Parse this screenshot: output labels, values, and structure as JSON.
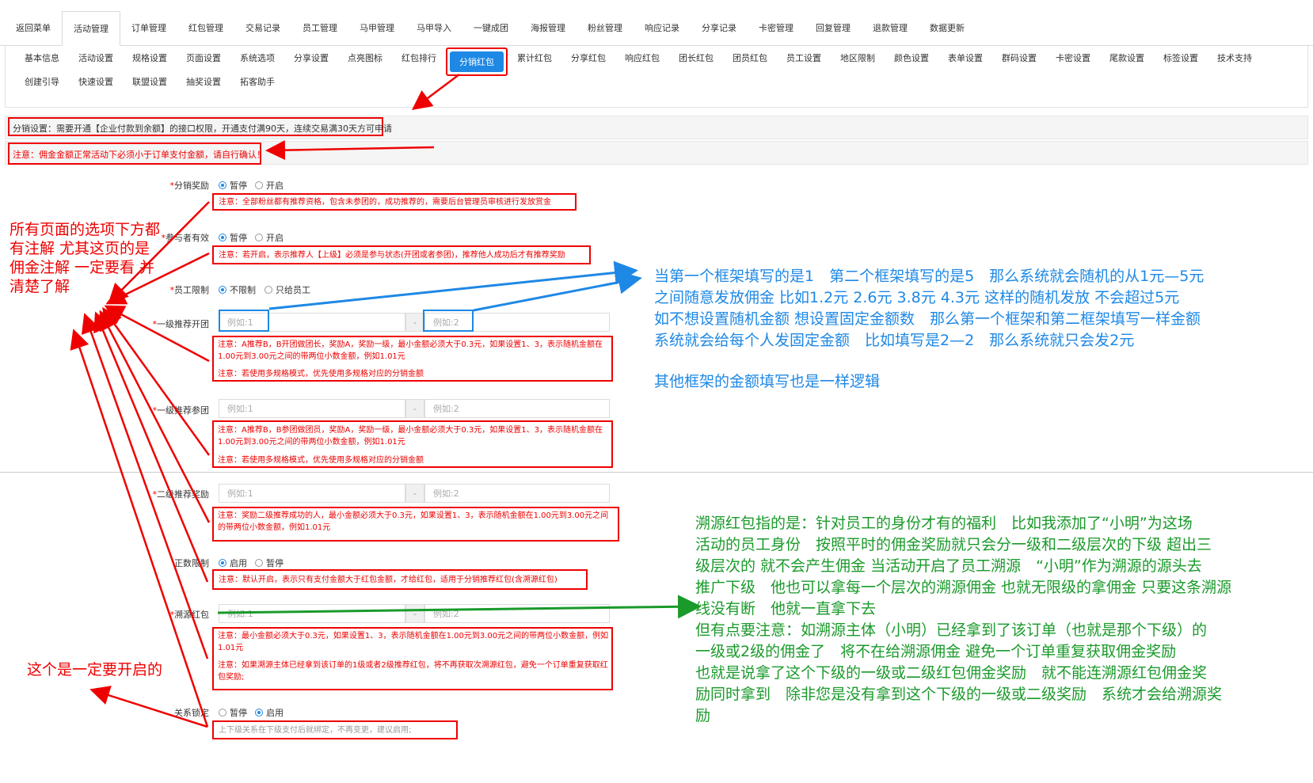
{
  "top_tabs": [
    "返回菜单",
    "活动管理",
    "订单管理",
    "红包管理",
    "交易记录",
    "员工管理",
    "马甲管理",
    "马甲导入",
    "一键成团",
    "海报管理",
    "粉丝管理",
    "响应记录",
    "分享记录",
    "卡密管理",
    "回复管理",
    "退款管理",
    "数据更新"
  ],
  "sub_tabs_row1": [
    "基本信息",
    "活动设置",
    "规格设置",
    "页面设置",
    "系统选项",
    "分享设置",
    "点亮图标",
    "红包排行",
    "分销红包",
    "累计红包",
    "分享红包",
    "响应红包",
    "团长红包",
    "团员红包",
    "员工设置",
    "地区限制",
    "颜色设置",
    "表单设置",
    "群码设置",
    "卡密设置",
    "尾款设置",
    "标签设置",
    "技术支持"
  ],
  "sub_tabs_row2": [
    "创建引导",
    "快速设置",
    "联盟设置",
    "抽奖设置",
    "拓客助手"
  ],
  "notices": {
    "dist_setting": "分销设置：需要开通【企业付款到余额】的接口权限，开通支付满90天，连续交易满30天方可申请",
    "commission_warning": "注意：佣金金额正常活动下必须小于订单支付金额，请自行确认！"
  },
  "form": {
    "fenxiao_label": "分销奖励",
    "fenxiao_note": "注意：全部粉丝都有推荐资格，包含未参团的，成功推荐的，需要后台管理员审核进行发放赏金",
    "canyu_label": "参与者有效",
    "canyu_note": "注意：若开启，表示推荐人【上级】必须是参与状态(开团或者参团)，推荐他人成功后才有推荐奖励",
    "yuangong_label": "员工限制",
    "yuangong_opt1": "不限制",
    "yuangong_opt2": "只给员工",
    "yiji_kt_label": "一级推荐开团",
    "yiji_kt_note1": "注意：A推荐B，B开团做团长，奖励A，奖励一级，最小金额必须大于0.3元，如果设置1、3，表示随机金额在1.00元到3.00元之间的带两位小数金额，例如1.01元",
    "yiji_kt_note2": "注意：若使用多规格模式，优先使用多规格对应的分销金额",
    "yiji_ct_label": "一级推荐参团",
    "yiji_ct_note1": "注意：A推荐B，B参团做团员，奖励A，奖励一级，最小金额必须大于0.3元，如果设置1、3，表示随机金额在1.00元到3.00元之间的带两位小数金额，例如1.01元",
    "yiji_ct_note2": "注意：若使用多规格模式，优先使用多规格对应的分销金额",
    "erji_label": "二级推荐奖励",
    "erji_note": "注意：奖励二级推荐成功的人，最小金额必须大于0.3元，如果设置1、3，表示随机金额在1.00元到3.00元之间的带两位小数金额，例如1.01元",
    "zhengshu_label": "正数限制",
    "zhengshu_note": "注意：默认开启，表示只有支付金额大于红包金额，才给红包，适用于分销推荐红包(含溯源红包)",
    "suyuan_label": "溯源红包",
    "suyuan_note1": "注意：最小金额必须大于0.3元，如果设置1、3，表示随机金额在1.00元到3.00元之间的带两位小数金额，例如1.01元",
    "suyuan_note2": "注意：如果溯源主体已经拿到该订单的1级或者2级推荐红包，将不再获取次溯源红包，避免一个订单重复获取红包奖励;",
    "guanxi_label": "关系锁定",
    "guanxi_note": "上下级关系在下级支付后就绑定，不再变更，建议启用;",
    "opt_pause": "暂停",
    "opt_open": "开启",
    "opt_enable": "启用",
    "ph1": "例如:1",
    "ph2": "例如:2",
    "dash": "-"
  },
  "annotations": {
    "left_red": "所有页面的选项下方都有注解 尤其这页的是佣金注解 一定要看 并清楚了解",
    "must_enable": "这个是一定要开启的",
    "blue_lines": [
      "当第一个框架填写的是1　第二个框架填写的是5　那么系统就会随机的从1元—5元",
      "之间随意发放佣金 比如1.2元 2.6元 3.8元 4.3元 这样的随机发放 不会超过5元",
      "如不想设置随机金额 想设置固定金额数　那么第一个框架和第二框架填写一样金额",
      "系统就会给每个人发固定金额　比如填写是2—2　那么系统就只会发2元"
    ],
    "blue_last": "其他框架的金额填写也是一样逻辑",
    "green_lines": [
      "溯源红包指的是：针对员工的身份才有的福利　比如我添加了“小明”为这场",
      "活动的员工身份　按照平时的佣金奖励就只会分一级和二级层次的下级 超出三",
      "级层次的 就不会产生佣金 当活动开启了员工溯源　“小明”作为溯源的源头去",
      "推广下级　他也可以拿每一个层次的溯源佣金 也就无限级的拿佣金 只要这条溯源",
      "线没有断　他就一直拿下去",
      "但有点要注意：如溯源主体（小明）已经拿到了该订单（也就是那个下级）的",
      "一级或2级的佣金了　将不在给溯源佣金 避免一个订单重复获取佣金奖励",
      "也就是说拿了这个下级的一级或二级红包佣金奖励　就不能连溯源红包佣金奖",
      "励同时拿到　除非您是没有拿到这个下级的一级或二级奖励　系统才会给溯源奖",
      "励"
    ]
  },
  "colors": {
    "accent": "#1e88e5",
    "annot_red": "#e00000",
    "annot_blue": "#1e88e5",
    "annot_green": "#1a9a2a"
  }
}
